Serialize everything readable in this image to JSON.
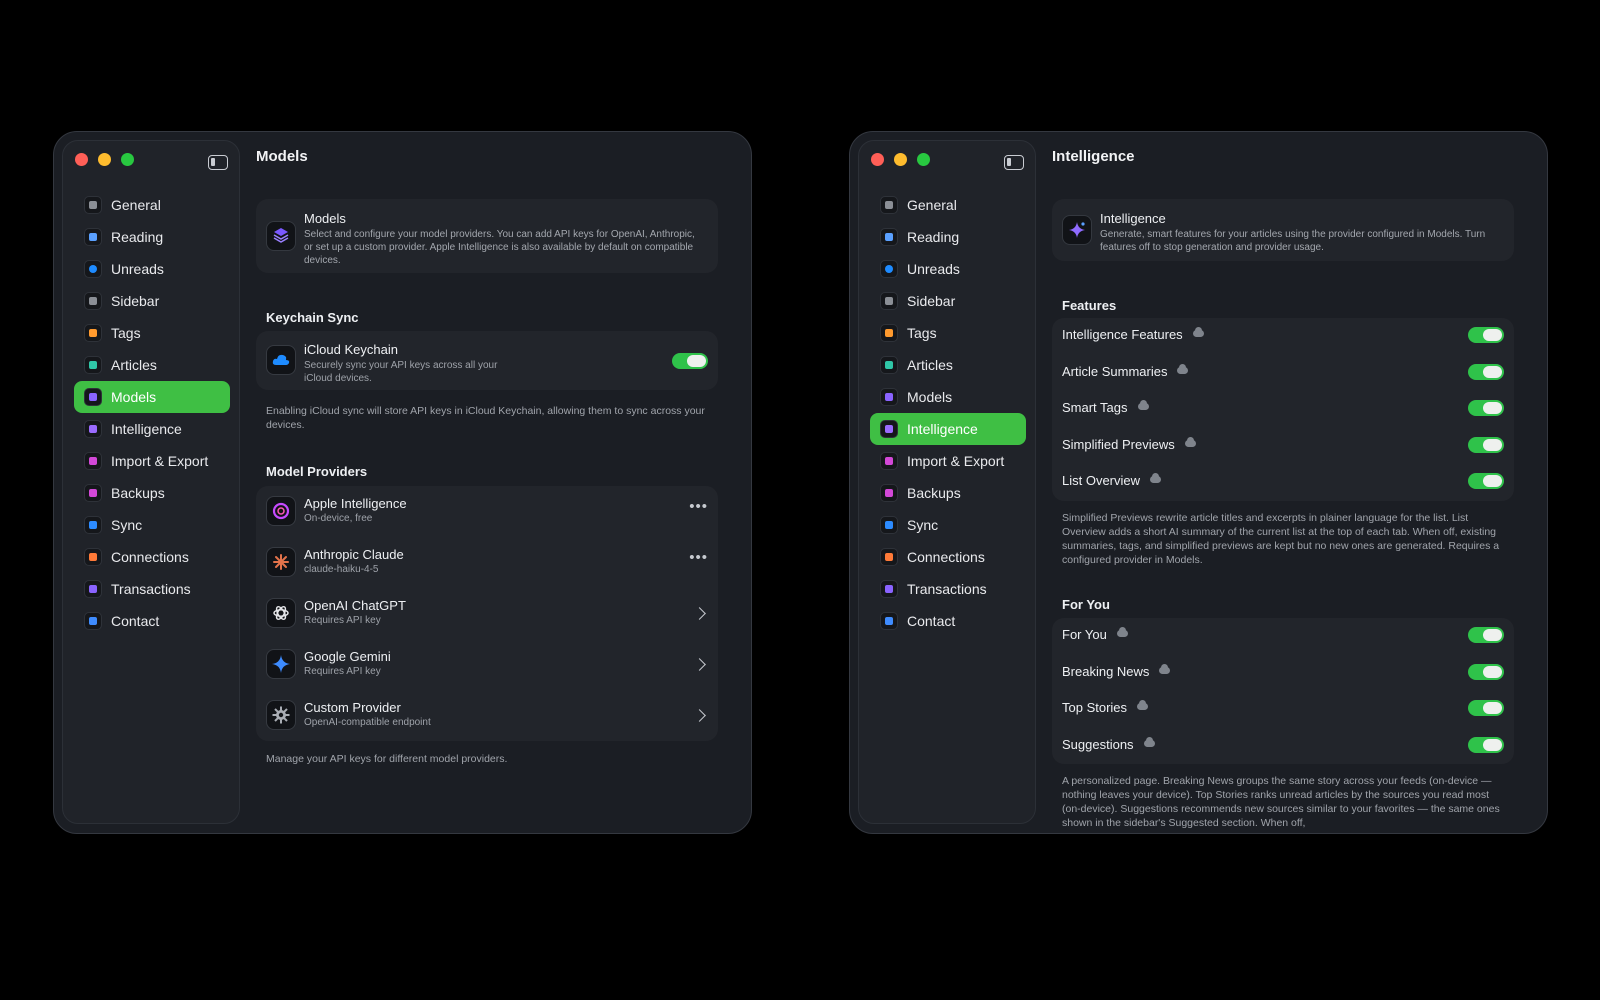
{
  "sidebar_items": [
    {
      "label": "General",
      "icon": "clock-icon",
      "color": "#8b8f96"
    },
    {
      "label": "Reading",
      "icon": "glasses-icon",
      "color": "#5aa0ff"
    },
    {
      "label": "Unreads",
      "icon": "dot-icon",
      "color": "#1e8bff"
    },
    {
      "label": "Sidebar",
      "icon": "sidebar-icon",
      "color": "#8b8f96"
    },
    {
      "label": "Tags",
      "icon": "hash-icon",
      "color": "#ff9a2e"
    },
    {
      "label": "Articles",
      "icon": "articles-icon",
      "color": "#2fc6a7"
    },
    {
      "label": "Models",
      "icon": "cube-icon",
      "color": "#8a63ff"
    },
    {
      "label": "Intelligence",
      "icon": "sparkle-icon",
      "color": "#9b6bff"
    },
    {
      "label": "Import & Export",
      "icon": "import-export-icon",
      "color": "#d348d8"
    },
    {
      "label": "Backups",
      "icon": "backup-icon",
      "color": "#d348d8"
    },
    {
      "label": "Sync",
      "icon": "sync-icon",
      "color": "#2c8bff"
    },
    {
      "label": "Connections",
      "icon": "link-icon",
      "color": "#ff7a38"
    },
    {
      "label": "Transactions",
      "icon": "receipt-icon",
      "color": "#8a63ff"
    },
    {
      "label": "Contact",
      "icon": "envelope-icon",
      "color": "#3f8cff"
    }
  ],
  "left": {
    "page_title": "Models",
    "hero": {
      "title": "Models",
      "description": "Select and configure your model providers. You can add API keys for OpenAI, Anthropic, or set up a custom provider. Apple Intelligence is also available by default on compatible devices."
    },
    "keychain_section": "Keychain Sync",
    "keychain": {
      "title": "iCloud Keychain",
      "description": "Securely sync your API keys across all your iCloud devices.",
      "enabled": true
    },
    "keychain_note": "Enabling iCloud sync will store API keys in iCloud Keychain, allowing them to sync across your devices.",
    "providers_section": "Model Providers",
    "providers": [
      {
        "name": "Apple Intelligence",
        "subtitle": "On-device, free",
        "action": "more",
        "icon": "apple-intelligence-icon"
      },
      {
        "name": "Anthropic Claude",
        "subtitle": "claude-haiku-4-5",
        "action": "more",
        "icon": "claude-icon"
      },
      {
        "name": "OpenAI ChatGPT",
        "subtitle": "Requires API key",
        "action": "chevron",
        "icon": "openai-icon"
      },
      {
        "name": "Google Gemini",
        "subtitle": "Requires API key",
        "action": "chevron",
        "icon": "gemini-icon"
      },
      {
        "name": "Custom Provider",
        "subtitle": "OpenAI-compatible endpoint",
        "action": "chevron",
        "icon": "gear-icon"
      }
    ],
    "providers_note": "Manage your API keys for different model providers."
  },
  "right": {
    "page_title": "Intelligence",
    "hero": {
      "title": "Intelligence",
      "description": "Generate, smart features for your articles using the provider configured in Models. Turn features off to stop generation and provider usage."
    },
    "features_section": "Features",
    "features": [
      {
        "label": "Intelligence Features",
        "enabled": true
      },
      {
        "label": "Article Summaries",
        "enabled": true
      },
      {
        "label": "Smart Tags",
        "enabled": true
      },
      {
        "label": "Simplified Previews",
        "enabled": true
      },
      {
        "label": "List Overview",
        "enabled": true
      }
    ],
    "features_note": "Simplified Previews rewrite article titles and excerpts in plainer language for the list. List Overview adds a short AI summary of the current list at the top of each tab. When off, existing summaries, tags, and simplified previews are kept but no new ones are generated. Requires a configured provider in Models.",
    "foryou_section": "For You",
    "foryou": [
      {
        "label": "For You",
        "enabled": true
      },
      {
        "label": "Breaking News",
        "enabled": true
      },
      {
        "label": "Top Stories",
        "enabled": true
      },
      {
        "label": "Suggestions",
        "enabled": true
      }
    ],
    "foryou_note": "A personalized page. Breaking News groups the same story across your feeds (on-device — nothing leaves your device). Top Stories ranks unread articles by the sources you read most (on-device). Suggestions recommends new sources similar to your favorites — the same ones shown in the sidebar's Suggested section. When off,"
  },
  "colors": {
    "accent": "#3fbf44",
    "toggle_on": "#2fc24a",
    "window_bg": "#1b1e24",
    "sidebar_bg": "#202329"
  }
}
